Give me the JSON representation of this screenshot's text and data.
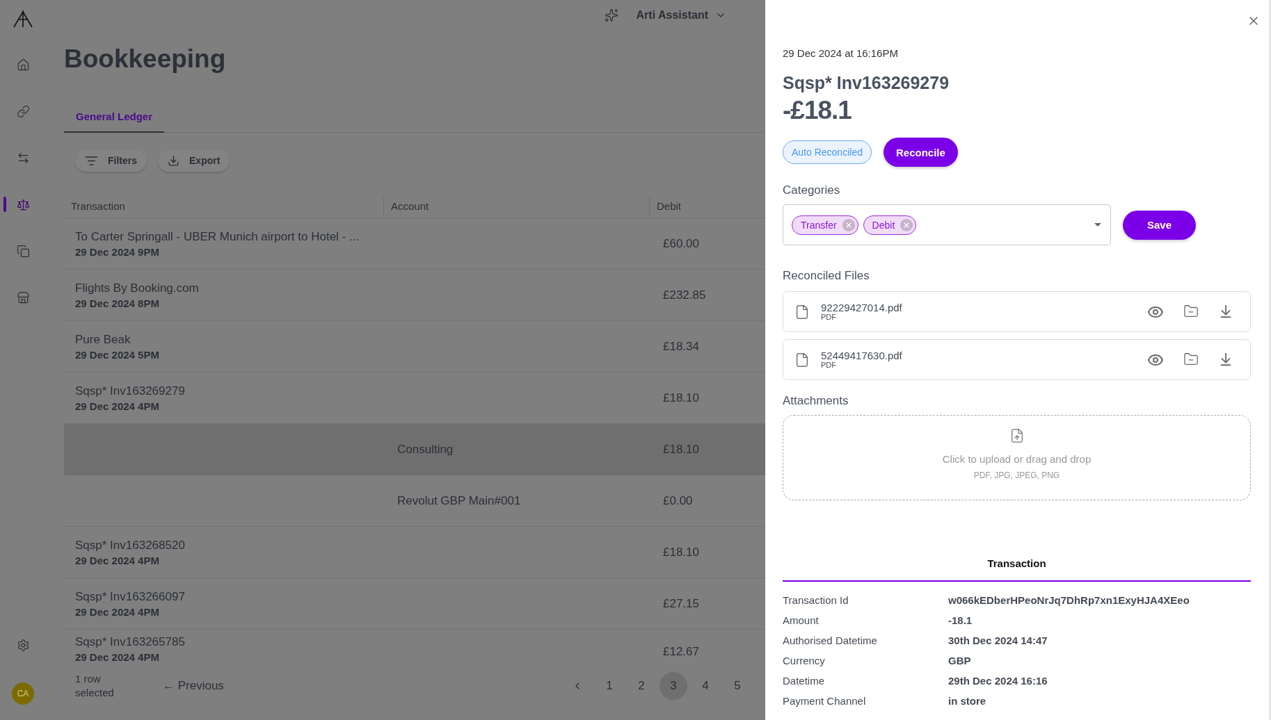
{
  "topbar": {
    "assistant": "Arti Assistant"
  },
  "sidebar": {
    "items": [
      {
        "selected": false
      },
      {
        "selected": false
      },
      {
        "selected": false
      },
      {
        "selected": true
      },
      {
        "selected": false
      },
      {
        "selected": false
      }
    ],
    "avatar": "CA"
  },
  "page": {
    "title": "Bookkeeping"
  },
  "tabs": [
    {
      "label": "General Ledger",
      "selected": true
    }
  ],
  "toolbar": {
    "buttons": [
      "Filters",
      "Export"
    ]
  },
  "table": {
    "columns": [
      "Transaction",
      "Account",
      "Debit"
    ],
    "rows": [
      {
        "kind": "transaction",
        "name": "To Carter Springall - UBER Munich airport to Hotel - ...",
        "date": "29 Dec 2024 9PM",
        "debit": "£60.00",
        "selected": false
      },
      {
        "kind": "transaction",
        "name": "Flights By Booking.com",
        "date": "29 Dec 2024 8PM",
        "debit": "£232.85",
        "selected": false
      },
      {
        "kind": "transaction",
        "name": "Pure Beak",
        "date": "29 Dec 2024 5PM",
        "debit": "£18.34",
        "selected": false
      },
      {
        "kind": "transaction",
        "name": "Sqsp* Inv163269279",
        "date": "29 Dec 2024 4PM",
        "debit": "£18.10",
        "selected": false
      },
      {
        "kind": "split",
        "account": "Consulting",
        "debit": "£18.10",
        "selected": true
      },
      {
        "kind": "split",
        "account": "Revolut GBP Main#001",
        "debit": "£0.00",
        "selected": false
      },
      {
        "kind": "transaction",
        "name": "Sqsp* Inv163268520",
        "date": "29 Dec 2024 4PM",
        "debit": "£18.10",
        "selected": false
      },
      {
        "kind": "transaction",
        "name": "Sqsp* Inv163266097",
        "date": "29 Dec 2024 4PM",
        "debit": "£27.15",
        "selected": false
      },
      {
        "kind": "transaction",
        "name": "Sqsp* Inv163265785",
        "date": "29 Dec 2024 4PM",
        "debit": "£12.67",
        "selected": false
      }
    ]
  },
  "footer": {
    "selection": "1 row selected",
    "previous": "← Previous",
    "pages": [
      {
        "label": "1",
        "selected": false
      },
      {
        "label": "2",
        "selected": false
      },
      {
        "label": "3",
        "selected": true
      },
      {
        "label": "4",
        "selected": false
      },
      {
        "label": "5",
        "selected": false
      }
    ]
  },
  "detail": {
    "datetime": "29 Dec 2024 at 16:16PM",
    "title": "Sqsp* Inv163269279",
    "amount": "-£18.1",
    "status": "Auto Reconciled",
    "reconcile": "Reconcile",
    "categories_label": "Categories",
    "categories": [
      "Transfer",
      "Debit"
    ],
    "save": "Save",
    "files_label": "Reconciled Files",
    "files": [
      {
        "name": "92229427014.pdf",
        "type": "PDF"
      },
      {
        "name": "52449417630.pdf",
        "type": "PDF"
      }
    ],
    "attachments_label": "Attachments",
    "upload": {
      "prompt": "Click to upload or drag and drop",
      "formats": "PDF, JPG, JPEG, PNG"
    },
    "tabs": [
      {
        "label": "Transaction",
        "selected": true
      }
    ],
    "fields": [
      {
        "label": "Transaction Id",
        "value": "w066kEDberHPeoNrJq7DhRp7xn1ExyHJA4XEeo"
      },
      {
        "label": "Amount",
        "value": "-18.1"
      },
      {
        "label": "Authorised Datetime",
        "value": "30th Dec 2024 14:47"
      },
      {
        "label": "Currency",
        "value": "GBP"
      },
      {
        "label": "Datetime",
        "value": "29th Dec 2024 16:16"
      },
      {
        "label": "Payment Channel",
        "value": "in store"
      }
    ]
  }
}
